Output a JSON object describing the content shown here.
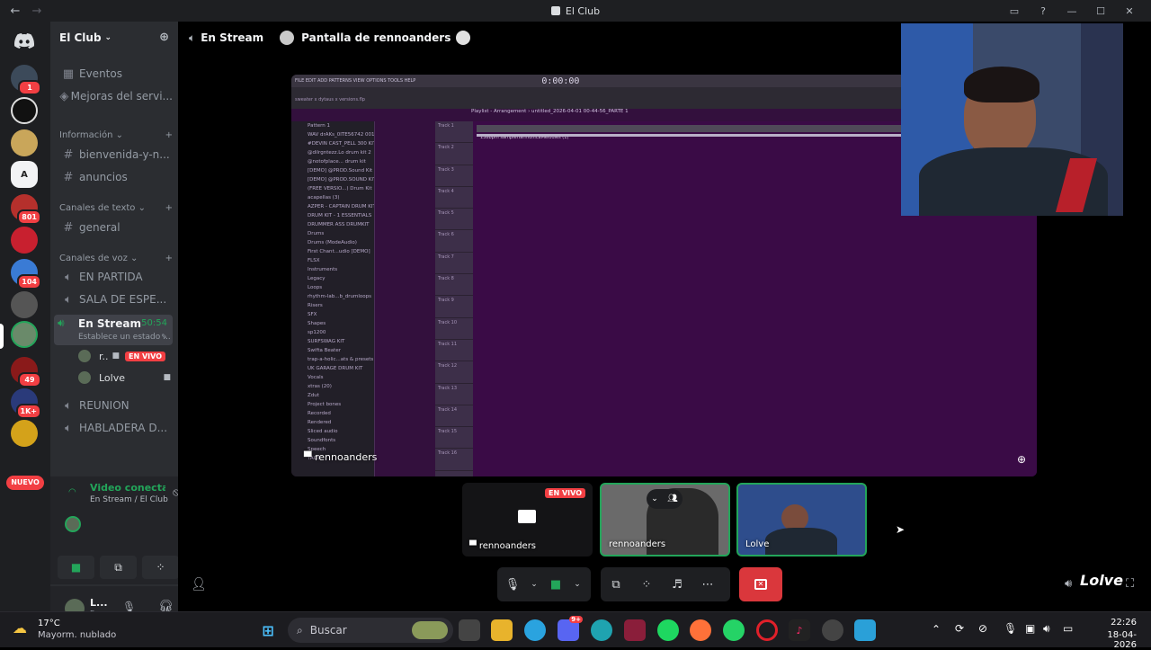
{
  "window": {
    "title": "El Club",
    "back": "←",
    "forward": "→"
  },
  "guilds": {
    "badges": [
      "1",
      "801",
      "104",
      "49",
      "1K+"
    ],
    "nuevo": "NUEVO",
    "icon_text": {
      "letters": "A"
    }
  },
  "server": {
    "name": "El Club",
    "items": [
      {
        "label": "Eventos"
      },
      {
        "label": "Mejoras del servi..."
      }
    ],
    "categories": {
      "info": "Información",
      "text": "Canales de texto",
      "voice": "Canales de voz"
    },
    "info_channels": [
      "bienvenida-y-n...",
      "anuncios"
    ],
    "text_channels": [
      "general"
    ],
    "voice_channels": [
      "EN PARTIDA",
      "SALA DE ESPE..."
    ],
    "stream_channel": {
      "name": "En Stream",
      "time": "50:54",
      "status": "Establece un estado ..."
    },
    "voice_users": [
      {
        "name": "r..",
        "live": "EN VIVO"
      },
      {
        "name": "Lolve"
      }
    ],
    "more_voice": [
      "REUNION",
      "HABLADERA D..."
    ]
  },
  "voice_panel": {
    "status": "Video conectac",
    "location": "En Stream / El Club"
  },
  "user_panel": {
    "name": "L...",
    "sub": "E."
  },
  "topbar": {
    "channel": "En Stream",
    "screen_title": "Pantalla de rennoanders"
  },
  "fl": {
    "menu": "FILE EDIT ADD PATTERNS VIEW OPTIONS TOOLS HELP",
    "time": "0:00:00",
    "playlist_title": "Playlist - Arrangement › untitled_2026-04-01 00-44-56_PARTE 1",
    "file": "sweater x dytaus x versions.flp",
    "browser": [
      "Pattern 1",
      "WAV drAKs_0ITE56742 001",
      "#DEVIN CAST_PELL 300 KIT",
      "@dilrgntezz.Lo drum kit 2",
      "@notofplace... drum kit",
      "[DEMO] @PROD.Sound Kit",
      "[DEMO] @PROD.SOUND KIT",
      "(FREE VERSIO...) Drum Kit",
      "acapellas (3)",
      "AZPER - CAPTAIN DRUM KIT",
      "DRUM KIT - 1 ESSENTIALS",
      "DRUMMER ASS DRUMKIT",
      "Drums",
      "Drums (ModeAudio)",
      "First Chant...udio [DEMO]",
      "FLSX",
      "Instruments",
      "Legacy",
      "Loops",
      "rhythm-lab...b_drumloops",
      "Risers",
      "SFX",
      "Shapes",
      "sp1200",
      "SURFSWAG KIT",
      "Swifta Beater",
      "trap-a-holic...ats & presets",
      "UK GARAGE DRUM KIT",
      "Vocals",
      "xtras (20)",
      "Zdut",
      "Project bones",
      "Recorded",
      "Rendered",
      "Sliced audio",
      "Soundfonts",
      "Speech",
      "TAGS"
    ],
    "tracks": [
      "Track 1",
      "Track 2",
      "Track 3",
      "Track 4",
      "Track 5",
      "Track 6",
      "Track 7",
      "Track 8",
      "Track 9",
      "Track 10",
      "Track 11",
      "Track 12",
      "Track 13",
      "Track 14",
      "Track 15",
      "Track 16"
    ],
    "clip": "138bpm sampleHarmonicaMelodies (1)"
  },
  "stage": {
    "label": "rennoanders"
  },
  "thumbs": [
    {
      "label": "rennoanders",
      "live": "EN VIVO"
    },
    {
      "label": "rennoanders"
    },
    {
      "label": "Lolve"
    }
  ],
  "overlay": {
    "logo": "Lolve"
  },
  "taskbar": {
    "temp": "17°C",
    "weather": "Mayorm. nublado",
    "search": "Buscar",
    "time": "22:26",
    "date": "18-04-2026",
    "discord_badge": "9+"
  },
  "colors": {
    "live": "#f23f43",
    "green": "#23a55a",
    "blurple": "#5865f2",
    "end_call": "#da373c"
  }
}
